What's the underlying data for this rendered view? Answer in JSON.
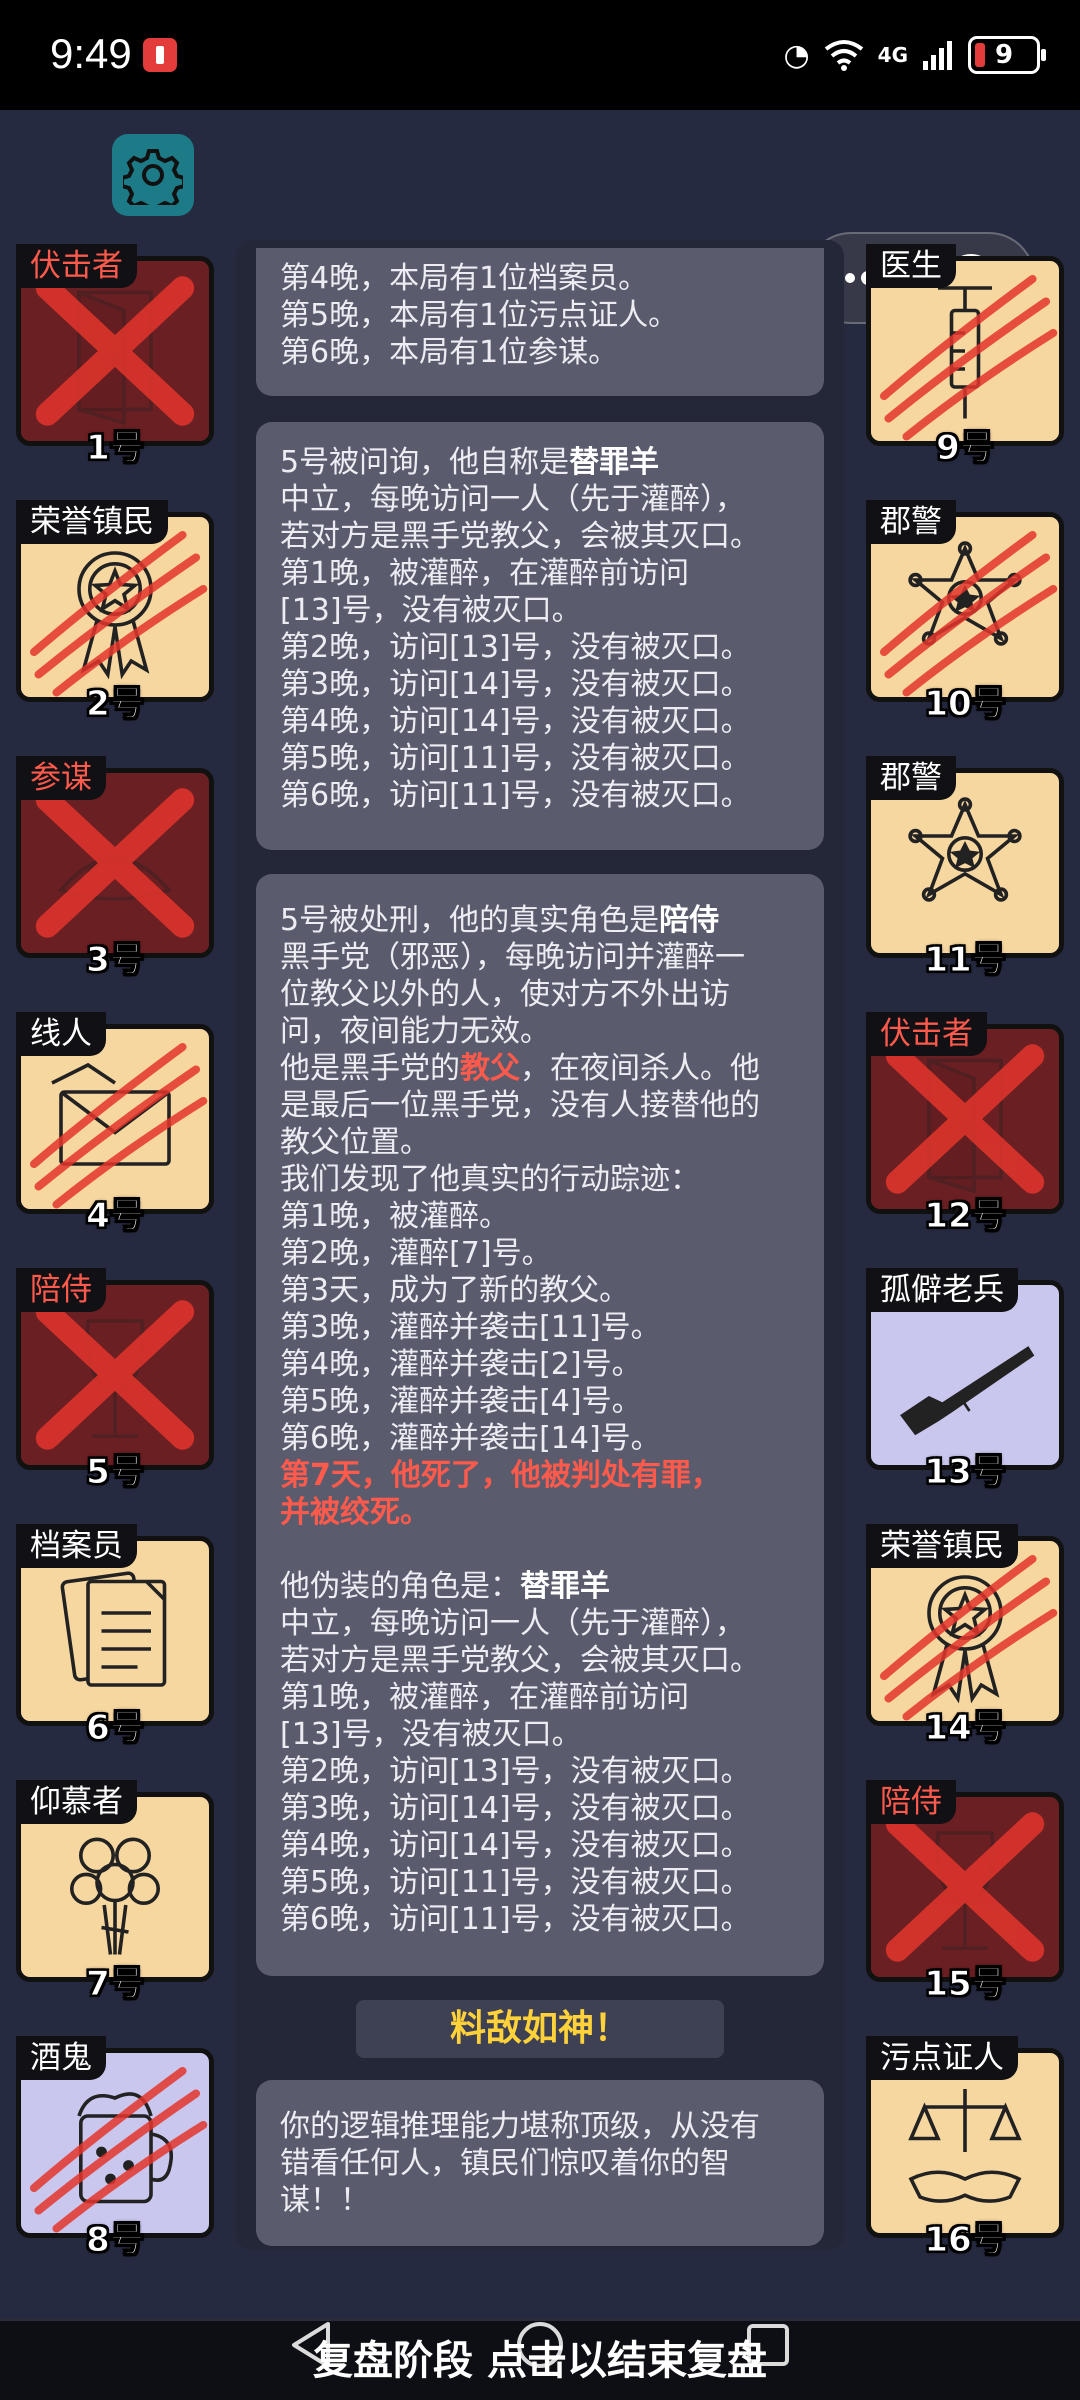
{
  "status_bar": {
    "time": "9:49",
    "network": "4G",
    "battery": "9"
  },
  "players_left": [
    {
      "role": "伏击者",
      "num": "1号",
      "role_color": "red",
      "state": "dead",
      "icon": "door-icon"
    },
    {
      "role": "荣誉镇民",
      "num": "2号",
      "role_color": "white",
      "state": "attacked",
      "icon": "medal-icon"
    },
    {
      "role": "参谋",
      "num": "3号",
      "role_color": "red",
      "state": "dead",
      "icon": "hat-icon"
    },
    {
      "role": "线人",
      "num": "4号",
      "role_color": "white",
      "state": "attacked",
      "icon": "envelope-icon"
    },
    {
      "role": "陪侍",
      "num": "5号",
      "role_color": "red",
      "state": "dead",
      "icon": "wine-glass-icon"
    },
    {
      "role": "档案员",
      "num": "6号",
      "role_color": "white",
      "state": "alive",
      "icon": "documents-icon"
    },
    {
      "role": "仰慕者",
      "num": "7号",
      "role_color": "white",
      "state": "alive",
      "icon": "roses-icon"
    },
    {
      "role": "酒鬼",
      "num": "8号",
      "role_color": "white",
      "state": "attacked-blue",
      "icon": "beer-mug-icon"
    }
  ],
  "players_right": [
    {
      "role": "医生",
      "num": "9号",
      "role_color": "white",
      "state": "attacked",
      "icon": "syringe-icon"
    },
    {
      "role": "郡警",
      "num": "10号",
      "role_color": "white",
      "state": "attacked",
      "icon": "sheriff-badge-icon"
    },
    {
      "role": "郡警",
      "num": "11号",
      "role_color": "white",
      "state": "alive",
      "icon": "sheriff-badge-icon"
    },
    {
      "role": "伏击者",
      "num": "12号",
      "role_color": "red",
      "state": "dead",
      "icon": "door-icon"
    },
    {
      "role": "孤僻老兵",
      "num": "13号",
      "role_color": "white",
      "state": "alive-blue",
      "icon": "rifle-icon"
    },
    {
      "role": "荣誉镇民",
      "num": "14号",
      "role_color": "white",
      "state": "attacked",
      "icon": "medal-icon"
    },
    {
      "role": "陪侍",
      "num": "15号",
      "role_color": "red",
      "state": "dead",
      "icon": "wine-glass-icon"
    },
    {
      "role": "污点证人",
      "num": "16号",
      "role_color": "white",
      "state": "alive",
      "icon": "scales-handshake-icon"
    }
  ],
  "log": {
    "msg1": [
      "第4晚，本局有1位档案员。",
      "第5晚，本局有1位污点证人。",
      "第6晚，本局有1位参谋。"
    ],
    "msg2": {
      "intro": "5号被问询，他自称是",
      "claimed_role": "替罪羊",
      "lines": [
        "中立，每晚访问一人（先于灌醉），",
        "若对方是黑手党教父，会被其灭口。",
        "第1晚，被灌醉，在灌醉前访问",
        "[13]号，没有被灭口。",
        "第2晚，访问[13]号，没有被灭口。",
        "第3晚，访问[14]号，没有被灭口。",
        "第4晚，访问[14]号，没有被灭口。",
        "第5晚，访问[11]号，没有被灭口。",
        "第6晚，访问[11]号，没有被灭口。"
      ]
    },
    "msg3": {
      "intro": "5号被处刑，他的真实角色是",
      "real_role": "陪侍",
      "desc": [
        "黑手党（邪恶），每晚访问并灌醉一",
        "位教父以外的人，使对方不外出访",
        "问，夜间能力无效。"
      ],
      "godfather_prefix": "他是黑手党的",
      "godfather_word": "教父",
      "godfather_suffix": "，在夜间杀人。他",
      "desc2": [
        "是最后一位黑手党，没有人接替他的",
        "教父位置。",
        "我们发现了他真实的行动踪迹：",
        "第1晚，被灌醉。",
        "第2晚，灌醉[7]号。",
        "第3天，成为了新的教父。",
        "第3晚，灌醉并袭击[11]号。",
        "第4晚，灌醉并袭击[2]号。",
        "第5晚，灌醉并袭击[4]号。",
        "第6晚，灌醉并袭击[14]号。"
      ],
      "death_lines": [
        "第7天，他死了，他被判处有罪，",
        "并被绞死。"
      ],
      "disguise_intro": "他伪装的角色是：",
      "disguise_role": "替罪羊",
      "disguise_lines": [
        "中立，每晚访问一人（先于灌醉），",
        "若对方是黑手党教父，会被其灭口。",
        "第1晚，被灌醉，在灌醉前访问",
        "[13]号，没有被灭口。",
        "第2晚，访问[13]号，没有被灭口。",
        "第3晚，访问[14]号，没有被灭口。",
        "第4晚，访问[14]号，没有被灭口。",
        "第5晚，访问[11]号，没有被灭口。",
        "第6晚，访问[11]号，没有被灭口。"
      ]
    },
    "banner": "料敌如神！",
    "msg4": [
      "你的逻辑推理能力堪称顶级，从没有",
      "错看任何人，镇民们惊叹着你的智",
      "谋！！"
    ]
  },
  "bottom": {
    "label": "复盘阶段 点击以结束复盘"
  },
  "colors": {
    "background": "#262a40",
    "card_tan": "#f7d7a0",
    "card_dead": "#6a1f22",
    "card_blue": "#c9c7ee",
    "red": "#ff5a4b",
    "gold": "#ffd23a"
  }
}
